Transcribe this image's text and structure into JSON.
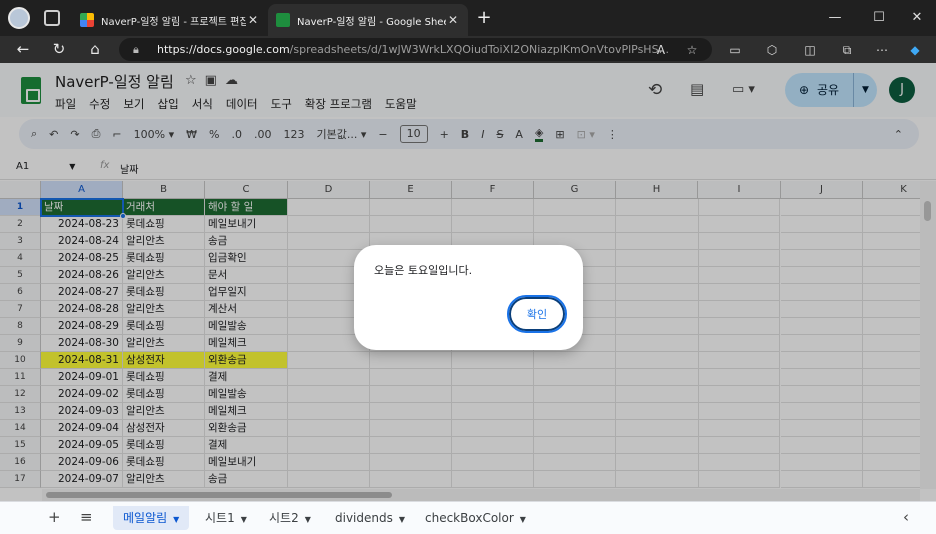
{
  "browser": {
    "tabs": [
      {
        "title": "NaverP-일정 알림 - 프로젝트 편집",
        "favicon": "apps-script-icon"
      },
      {
        "title": "NaverP-일정 알림 - Google Sheets",
        "favicon": "sheets-icon"
      }
    ],
    "url_host": "https://docs.google.com",
    "url_path": "/spreadsheets/d/1wJW3WrkLXQOiudToiXI2ONiazplKmOnVtovPlPsHS..."
  },
  "doc": {
    "title": "NaverP-일정 알림",
    "menus": [
      "파일",
      "수정",
      "보기",
      "삽입",
      "서식",
      "데이터",
      "도구",
      "확장 프로그램",
      "도움말"
    ],
    "share_label": "공유",
    "user_initial": "J"
  },
  "toolbar": {
    "zoom": "100%",
    "currency": "₩",
    "percent": "%",
    "dec_less": ".0",
    "dec_more": ".00",
    "number_format": "123",
    "font": "기본값...",
    "font_size": "10"
  },
  "formula": {
    "cell_ref": "A1",
    "value": "날짜"
  },
  "grid": {
    "columns": [
      "A",
      "B",
      "C",
      "D",
      "E",
      "F",
      "G",
      "H",
      "I",
      "J",
      "K"
    ],
    "rows": [
      {
        "n": "1",
        "a": "날짜",
        "b": "거래처",
        "c": "해야 할 일"
      },
      {
        "n": "2",
        "a": "2024-08-23",
        "b": "롯데쇼핑",
        "c": "메일보내기"
      },
      {
        "n": "3",
        "a": "2024-08-24",
        "b": "알리안츠",
        "c": "송금"
      },
      {
        "n": "4",
        "a": "2024-08-25",
        "b": "롯데쇼핑",
        "c": "입금확인"
      },
      {
        "n": "5",
        "a": "2024-08-26",
        "b": "알리안츠",
        "c": "문서"
      },
      {
        "n": "6",
        "a": "2024-08-27",
        "b": "롯데쇼핑",
        "c": "업무일지"
      },
      {
        "n": "7",
        "a": "2024-08-28",
        "b": "알리안츠",
        "c": "계산서"
      },
      {
        "n": "8",
        "a": "2024-08-29",
        "b": "롯데쇼핑",
        "c": "메일발송"
      },
      {
        "n": "9",
        "a": "2024-08-30",
        "b": "알리안츠",
        "c": "메일체크"
      },
      {
        "n": "10",
        "a": "2024-08-31",
        "b": "삼성전자",
        "c": "외환송금"
      },
      {
        "n": "11",
        "a": "2024-09-01",
        "b": "롯데쇼핑",
        "c": "결제"
      },
      {
        "n": "12",
        "a": "2024-09-02",
        "b": "롯데쇼핑",
        "c": "메일발송"
      },
      {
        "n": "13",
        "a": "2024-09-03",
        "b": "알리안츠",
        "c": "메일체크"
      },
      {
        "n": "14",
        "a": "2024-09-04",
        "b": "삼성전자",
        "c": "외환송금"
      },
      {
        "n": "15",
        "a": "2024-09-05",
        "b": "롯데쇼핑",
        "c": "결제"
      },
      {
        "n": "16",
        "a": "2024-09-06",
        "b": "롯데쇼핑",
        "c": "메일보내기"
      },
      {
        "n": "17",
        "a": "2024-09-07",
        "b": "알리안츠",
        "c": "송금"
      }
    ],
    "header_color": "#1e6c33",
    "highlight_row": "10",
    "highlight_color": "#ffff3a"
  },
  "sheets": {
    "tabs": [
      "메일알림",
      "시트1",
      "시트2",
      "dividends",
      "checkBoxColor"
    ],
    "active": "메일알림"
  },
  "dialog": {
    "message": "오늘은 토요일입니다.",
    "ok_label": "확인"
  }
}
